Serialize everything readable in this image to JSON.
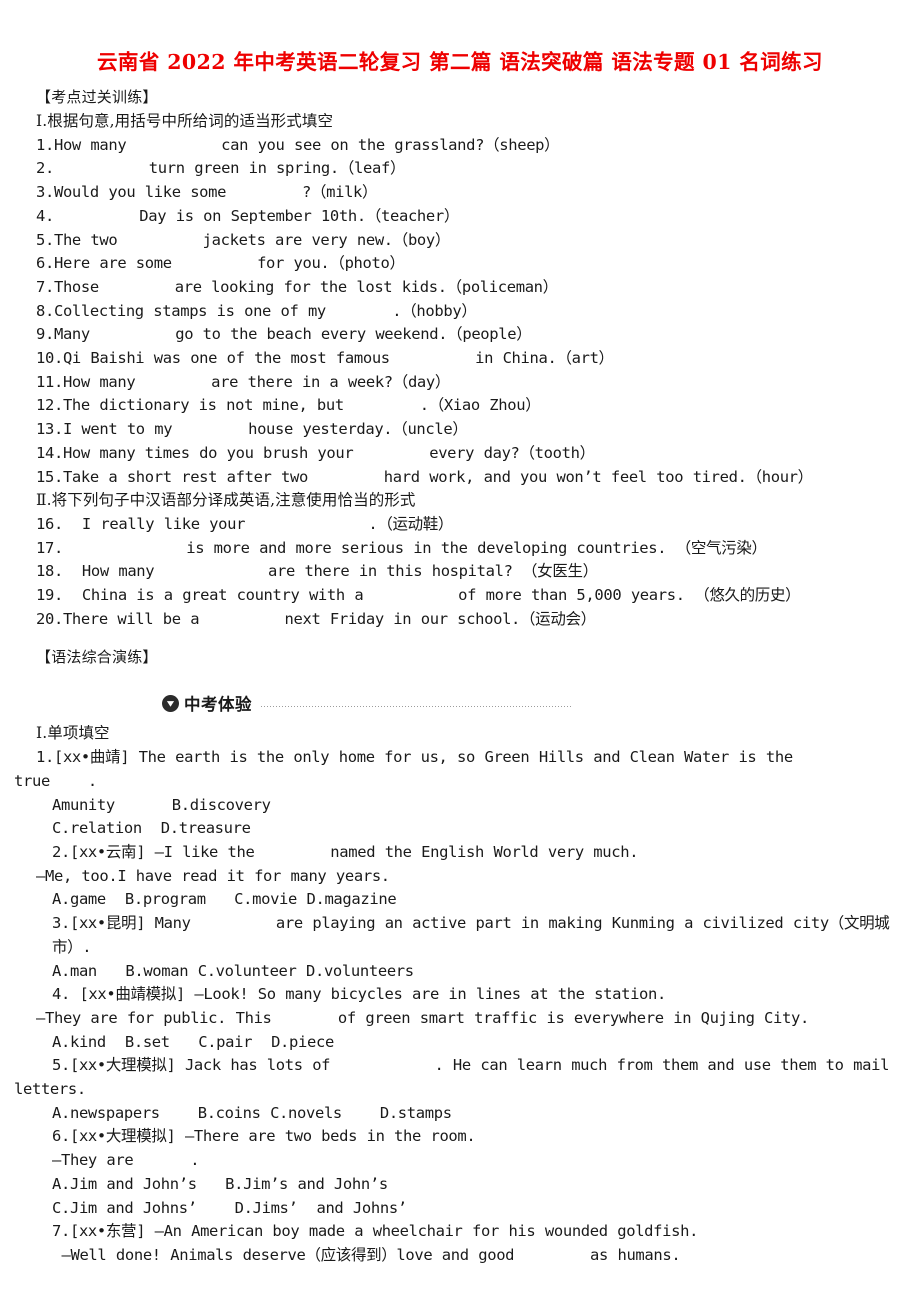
{
  "document": {
    "title": "云南省 2022 年中考英语二轮复习 第二篇 语法突破篇 语法专题 01 名词练习",
    "title_color": "#ee0000"
  },
  "section_one": {
    "heading": "【考点过关训练】",
    "part_i_heading": "Ⅰ.根据句意,用括号中所给词的适当形式填空",
    "fill_in_blank_items": [
      "1.How many          can you see on the grassland?（sheep）",
      "2.          turn green in spring.（leaf）",
      "3.Would you like some        ?（milk）",
      "4.         Day is on September 10th.（teacher）",
      "5.The two         jackets are very new.（boy）",
      "6.Here are some         for you.（photo）",
      "7.Those        are looking for the lost kids.（policeman）",
      "8.Collecting stamps is one of my       .（hobby）",
      "9.Many         go to the beach every weekend.（people）",
      "10.Qi Baishi was one of the most famous         in China.（art）",
      "11.How many        are there in a week?（day）",
      "12.The dictionary is not mine, but        .（Xiao Zhou）",
      "13.I went to my        house yesterday.（uncle）",
      "14.How many times do you brush your        every day?（tooth）",
      "15.Take a short rest after two        hard work, and you won’t feel too tired.（hour）"
    ],
    "part_ii_heading": "Ⅱ.将下列句子中汉语部分译成英语,注意使用恰当的形式",
    "translation_items": [
      "16.  I really like your             .（运动鞋）",
      "17.             is more and more serious in the developing countries. （空气污染）",
      "18.  How many            are there in this hospital? （女医生）",
      "19.  China is a great country with a          of more than 5,000 years. （悠久的历史）",
      "20.There will be a         next Friday in our school.（运动会）"
    ]
  },
  "section_two": {
    "heading": "【语法综合演练】",
    "banner_label": "中考体验",
    "banner_icon": "down-triangle-badge-icon",
    "part_i_heading": "Ⅰ.单项填空",
    "questions": [
      {
        "stem_line_1": "1.[xx•曲靖] The earth is the only home for us, so Green Hills and Clean Water is the",
        "stem_line_2": "true    .",
        "options": [
          "Amunity      B.discovery",
          "C.relation  D.treasure"
        ]
      },
      {
        "stem_line_1": "2.[xx•云南] —I like the        named the English World very much.",
        "stem_line_2": "—Me, too.I have read it for many years.",
        "options": [
          "A.game  B.program   C.movie D.magazine"
        ]
      },
      {
        "stem_line_1": "3.[xx•昆明] Many         are playing an active part in making Kunming a civilized city（文明城市）.",
        "options": [
          "A.man   B.woman C.volunteer D.volunteers"
        ]
      },
      {
        "stem_line_1": "4. [xx•曲靖模拟] —Look! So many bicycles are in lines at the station.",
        "stem_line_2": "—They are for public. This       of green smart traffic is everywhere in Qujing City.",
        "options": [
          "A.kind  B.set   C.pair  D.piece"
        ]
      },
      {
        "stem_line_1": "5.[xx•大理模拟] Jack has lots of           . He can learn much from them and use them to mail",
        "stem_line_2": "letters.",
        "options": [
          "A.newspapers    B.coins C.novels    D.stamps"
        ]
      },
      {
        "stem_line_1": "6.[xx•大理模拟] —There are two beds in the room.",
        "stem_line_2": "—They are      .",
        "options": [
          "A.Jim and John’s   B.Jim’s and John’s",
          "C.Jim and Johns’    D.Jims’  and Johns’"
        ]
      },
      {
        "stem_line_1": "7.[xx•东营] —An American boy made a wheelchair for his wounded goldfish.",
        "stem_line_2": " —Well done! Animals deserve（应该得到）love and good        as humans."
      }
    ]
  }
}
